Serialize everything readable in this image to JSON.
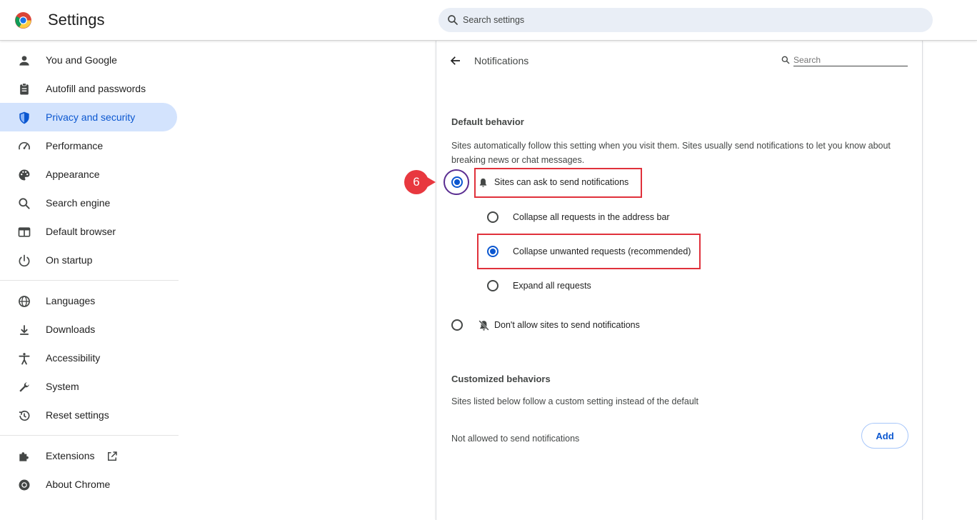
{
  "header": {
    "app_title": "Settings",
    "search_placeholder": "Search settings",
    "logo_icon": "chrome-logo-icon"
  },
  "sidebar": {
    "items": [
      {
        "label": "You and Google",
        "icon": "person-icon"
      },
      {
        "label": "Autofill and passwords",
        "icon": "clipboard-icon"
      },
      {
        "label": "Privacy and security",
        "icon": "shield-icon",
        "active": true
      },
      {
        "label": "Performance",
        "icon": "speedometer-icon"
      },
      {
        "label": "Appearance",
        "icon": "palette-icon"
      },
      {
        "label": "Search engine",
        "icon": "search-icon"
      },
      {
        "label": "Default browser",
        "icon": "browser-window-icon"
      },
      {
        "label": "On startup",
        "icon": "power-icon"
      },
      {
        "label": "Languages",
        "icon": "globe-icon"
      },
      {
        "label": "Downloads",
        "icon": "download-icon"
      },
      {
        "label": "Accessibility",
        "icon": "accessibility-icon"
      },
      {
        "label": "System",
        "icon": "wrench-icon"
      },
      {
        "label": "Reset settings",
        "icon": "history-icon"
      },
      {
        "label": "Extensions",
        "icon": "puzzle-icon"
      },
      {
        "label": "About Chrome",
        "icon": "chrome-icon"
      }
    ]
  },
  "panel": {
    "title": "Notifications",
    "search_placeholder": "Search",
    "default_heading": "Default behavior",
    "default_desc": "Sites automatically follow this setting when you visit them. Sites usually send notifications to let you know about breaking news or chat messages.",
    "options": {
      "ask": "Sites can ask to send notifications",
      "collapse_all": "Collapse all requests in the address bar",
      "collapse_unwanted": "Collapse unwanted requests (recommended)",
      "expand_all": "Expand all requests",
      "block": "Don't allow sites to send notifications"
    },
    "selected": {
      "main": "ask",
      "sub": "collapse_unwanted"
    },
    "custom_heading": "Customized behaviors",
    "custom_desc": "Sites listed below follow a custom setting instead of the default",
    "not_allowed": "Not allowed to send notifications",
    "add_button": "Add"
  },
  "annotation": {
    "step_number": "6",
    "highlight_color": "#e0313b",
    "badge_color": "#e8383f",
    "circle_color": "#5a2d91"
  },
  "colors": {
    "accent": "#0b57d0",
    "active_nav_bg": "#d3e3fd",
    "search_bg": "#e9eef6"
  }
}
